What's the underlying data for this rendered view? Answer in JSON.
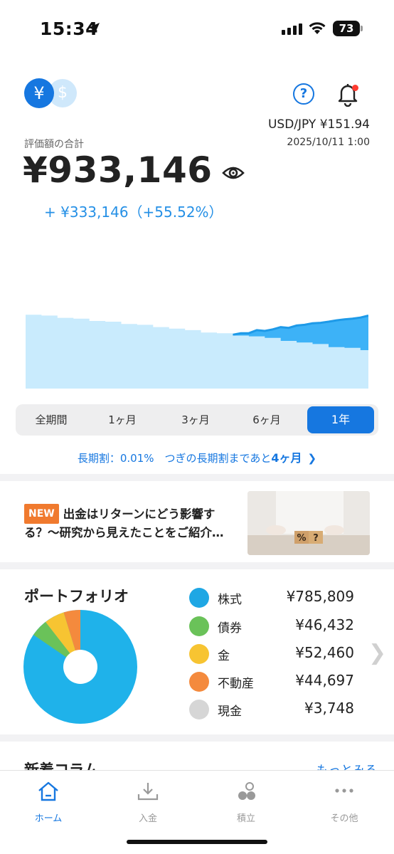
{
  "status_bar": {
    "time": "15:34",
    "battery": "73"
  },
  "header": {
    "currency_yen": "¥",
    "currency_usd": "$",
    "help": "?",
    "fx_rate": "USD/JPY ¥151.94",
    "fx_timestamp": "2025/10/11 1:00"
  },
  "summary": {
    "label": "評価額の合計",
    "total": "¥933,146",
    "gain": "+ ¥333,146（+55.52%）"
  },
  "chart_data": {
    "type": "area",
    "series": [
      {
        "values": [
          0.74,
          0.73,
          0.74,
          0.735,
          0.725,
          0.73,
          0.72,
          0.718,
          0.725,
          0.73,
          0.735,
          0.72,
          0.718,
          0.712,
          0.72,
          0.718,
          0.7,
          0.725,
          0.67,
          0.688,
          0.69,
          0.675,
          0.67,
          0.66,
          0.665,
          0.655,
          0.65,
          0.64,
          0.64,
          0.62,
          0.625,
          0.615,
          0.6,
          0.605,
          0.59,
          0.585,
          0.575,
          0.572,
          0.565,
          0.556,
          0.55,
          0.545,
          0.538,
          0.525
        ]
      },
      {
        "values": [
          0.52,
          0.52,
          0.525,
          0.525,
          0.54,
          0.54,
          0.545,
          0.545,
          0.56,
          0.56,
          0.565,
          0.565,
          0.58,
          0.58,
          0.585,
          0.585,
          0.6,
          0.6,
          0.61,
          0.61,
          0.62,
          0.62,
          0.635,
          0.635,
          0.64,
          0.64,
          0.655,
          0.655,
          0.66,
          0.66,
          0.67,
          0.67,
          0.69,
          0.69,
          0.7,
          0.7,
          0.71,
          0.71,
          0.73,
          0.73,
          0.735,
          0.735,
          0.75,
          0.75
        ]
      }
    ],
    "colors": {
      "valuation": "#3db2f7",
      "deposit": "#c9ebfd"
    }
  },
  "periods": {
    "items": [
      "全期間",
      "1ヶ月",
      "3ヶ月",
      "6ヶ月",
      "1年"
    ],
    "active_index": 4
  },
  "longterm": {
    "prefix": "長期割：0.01%　つぎの長期割まであと",
    "months": "4ヶ月"
  },
  "article": {
    "badge": "NEW",
    "title": "出金はリターンにどう影響する？〜研究から見えたことをご紹介…",
    "thumb_text": "%?"
  },
  "portfolio": {
    "title": "ポートフォリオ",
    "assets": [
      {
        "name": "株式",
        "value": "¥785,809",
        "icon": "bank-icon",
        "color": "#1fa7e4"
      },
      {
        "name": "債券",
        "value": "¥46,432",
        "icon": "bond-icon",
        "color": "#6ac259"
      },
      {
        "name": "金",
        "value": "¥52,460",
        "icon": "gold-icon",
        "color": "#f7c432"
      },
      {
        "name": "不動産",
        "value": "¥44,697",
        "icon": "building-icon",
        "color": "#f48a3d"
      },
      {
        "name": "現金",
        "value": "¥3,748",
        "icon": "cash-icon",
        "color": "#d6d6d6"
      }
    ]
  },
  "column": {
    "title": "新着コラム",
    "more": "もっとみる"
  },
  "tabbar": [
    {
      "label": "ホーム",
      "icon": "home-icon"
    },
    {
      "label": "入金",
      "icon": "deposit-icon"
    },
    {
      "label": "積立",
      "icon": "savings-icon"
    },
    {
      "label": "その他",
      "icon": "more-icon"
    }
  ]
}
